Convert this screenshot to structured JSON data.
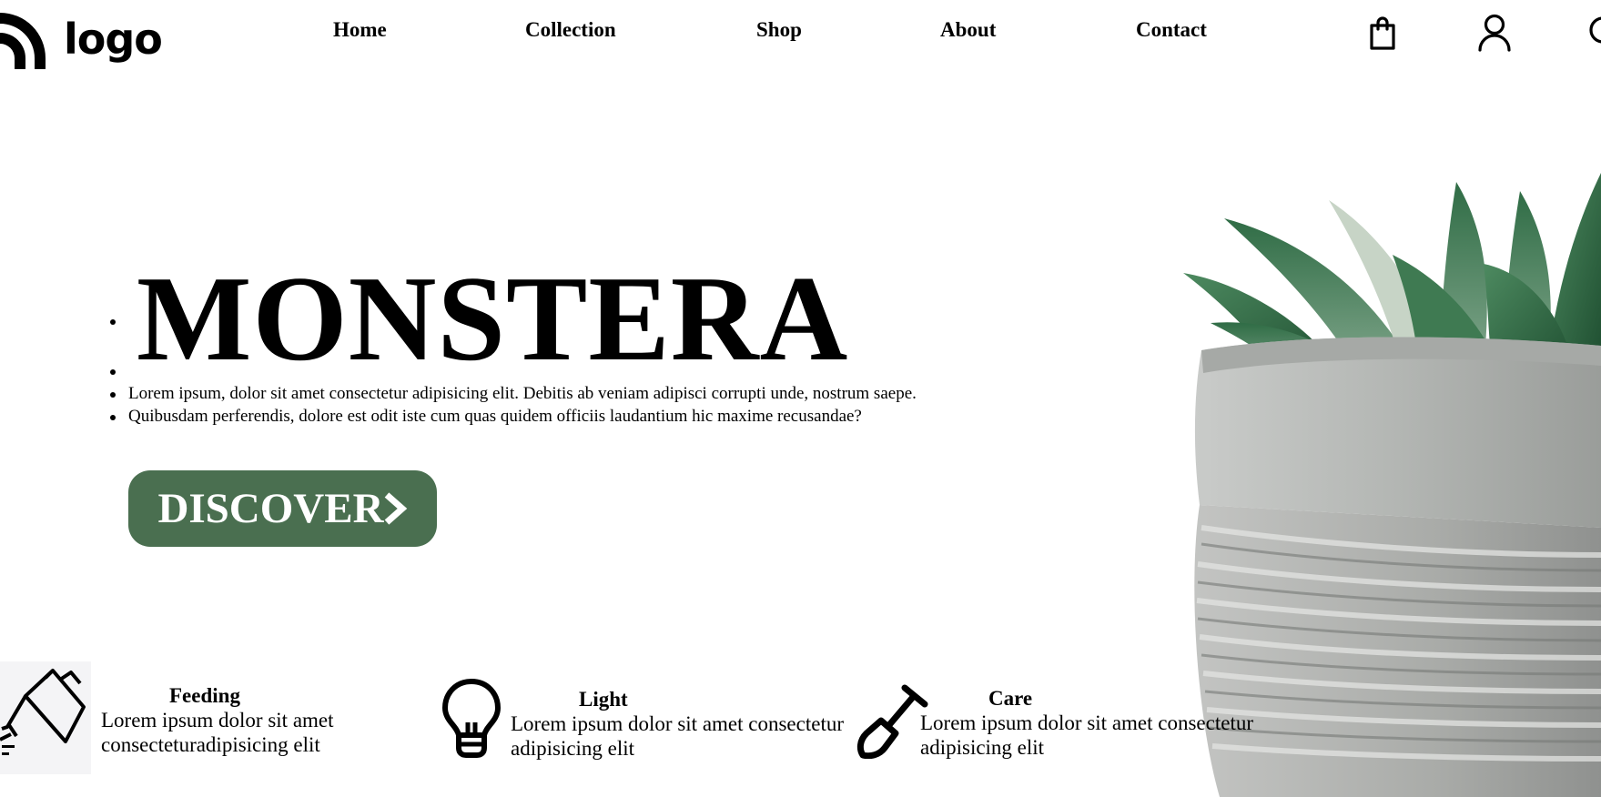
{
  "header": {
    "logo_text": "logo",
    "nav": [
      "Home",
      "Collection",
      "Shop",
      "About",
      "Contact"
    ],
    "icons": [
      "shopping-bag-icon",
      "user-icon",
      "search-icon"
    ]
  },
  "hero": {
    "title": "MONSTERA",
    "lines": [
      "Lorem ipsum, dolor sit amet consectetur adipisicing elit. Debitis ab veniam adipisci corrupti unde, nostrum saepe.",
      "Quibusdam perferendis, dolore est odit iste cum quas quidem officiis laudantium hic maxime recusandae?"
    ],
    "button_label": "DISCOVER",
    "button_color": "#4a6f50"
  },
  "features": [
    {
      "title": "Feeding",
      "text_line1": "Lorem ipsum dolor sit amet",
      "text_line2": "consecteturadipisicing elit",
      "icon": "watering-can-icon"
    },
    {
      "title": "Light",
      "text_line1": "Lorem ipsum dolor sit amet consectetur",
      "text_line2": "adipisicing elit",
      "icon": "light-bulb-icon"
    },
    {
      "title": "Care",
      "text_line1": "Lorem ipsum dolor sit amet consectetur",
      "text_line2": "adipisicing elit",
      "icon": "shovel-icon"
    }
  ]
}
